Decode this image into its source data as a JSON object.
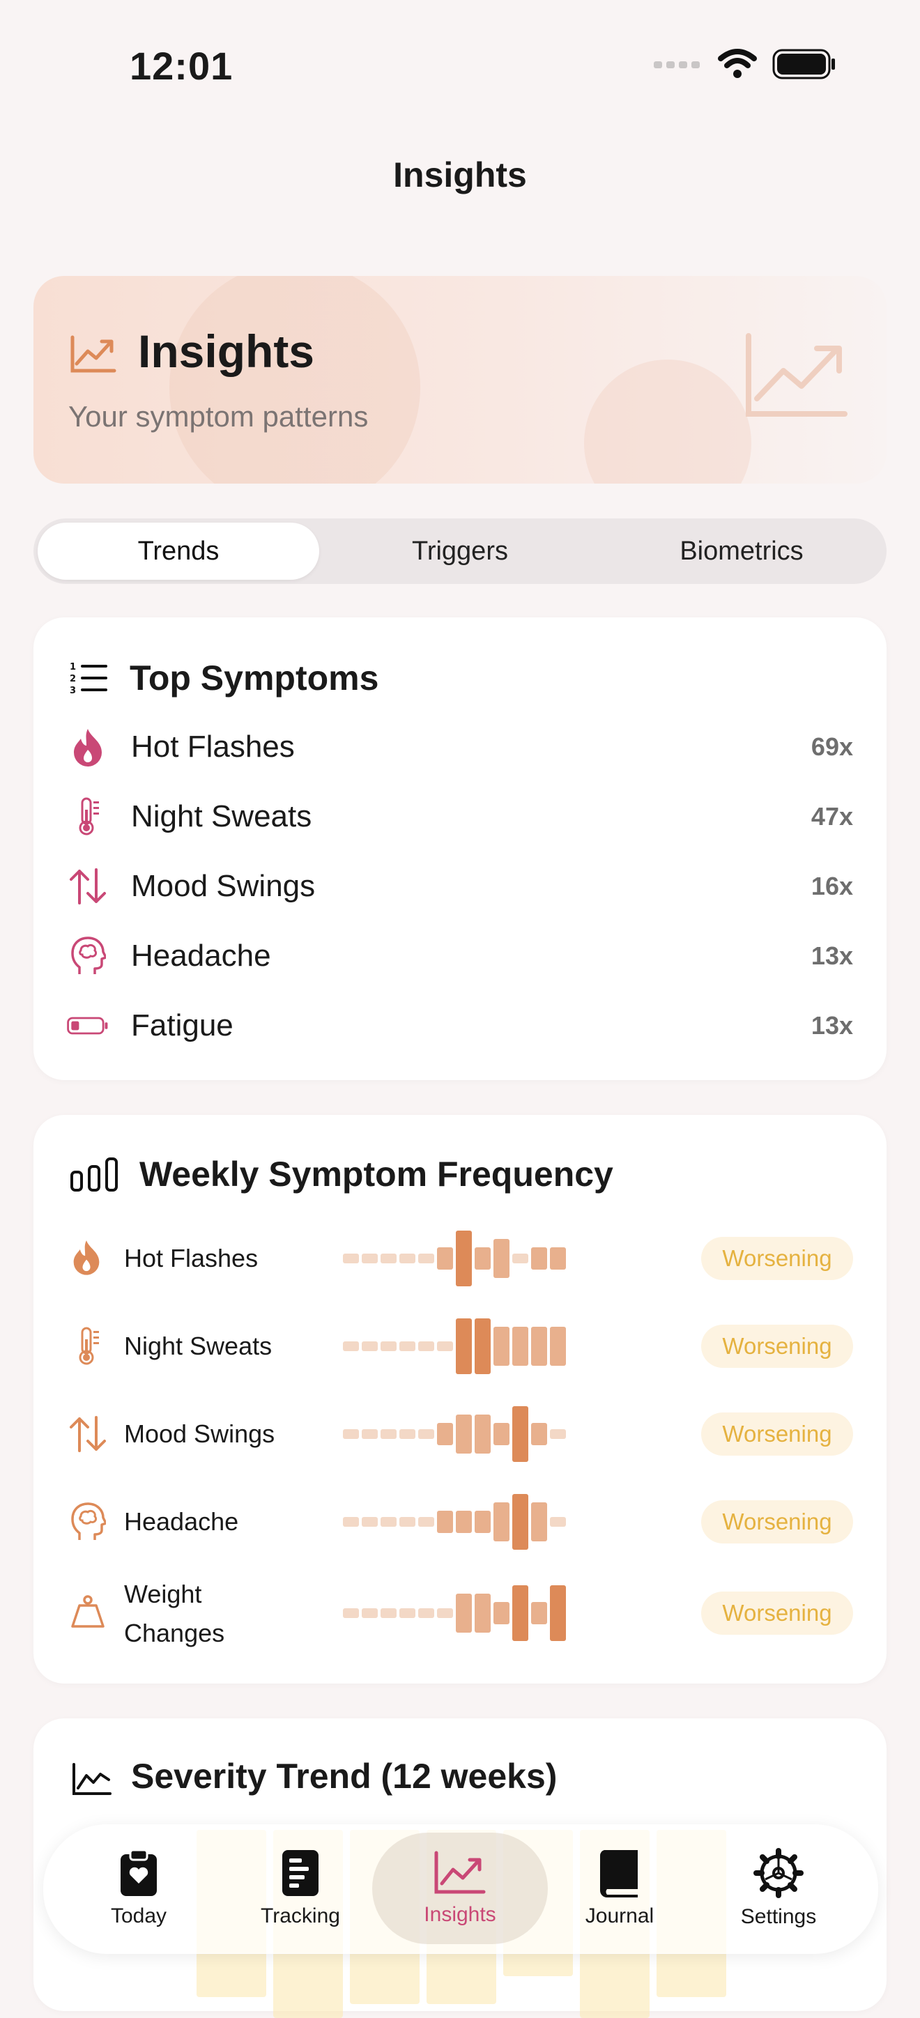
{
  "status_bar": {
    "time": "12:01"
  },
  "nav": {
    "title": "Insights"
  },
  "hero": {
    "title": "Insights",
    "subtitle": "Your symptom patterns"
  },
  "segments": [
    {
      "label": "Trends",
      "active": true
    },
    {
      "label": "Triggers",
      "active": false
    },
    {
      "label": "Biometrics",
      "active": false
    }
  ],
  "top_symptoms": {
    "title": "Top Symptoms",
    "items": [
      {
        "label": "Hot Flashes",
        "count": "69x",
        "icon": "flame-icon"
      },
      {
        "label": "Night Sweats",
        "count": "47x",
        "icon": "thermometer-icon"
      },
      {
        "label": "Mood Swings",
        "count": "16x",
        "icon": "up-down-arrows-icon"
      },
      {
        "label": "Headache",
        "count": "13x",
        "icon": "brain-head-icon"
      },
      {
        "label": "Fatigue",
        "count": "13x",
        "icon": "low-battery-icon"
      }
    ]
  },
  "weekly_frequency": {
    "title": "Weekly Symptom Frequency",
    "items": [
      {
        "label": "Hot Flashes",
        "status": "Worsening",
        "icon": "flame-icon",
        "levels": [
          1,
          1,
          1,
          1,
          1,
          2,
          4,
          2,
          3,
          1,
          2,
          2
        ]
      },
      {
        "label": "Night Sweats",
        "status": "Worsening",
        "icon": "thermometer-icon",
        "levels": [
          1,
          1,
          1,
          1,
          1,
          1,
          4,
          4,
          3,
          3,
          3,
          3
        ]
      },
      {
        "label": "Mood Swings",
        "status": "Worsening",
        "icon": "up-down-arrows-icon",
        "levels": [
          1,
          1,
          1,
          1,
          1,
          2,
          3,
          3,
          2,
          4,
          2,
          1
        ]
      },
      {
        "label": "Headache",
        "status": "Worsening",
        "icon": "brain-head-icon",
        "levels": [
          1,
          1,
          1,
          1,
          1,
          2,
          2,
          2,
          3,
          4,
          3,
          1
        ]
      },
      {
        "label": "Weight Changes",
        "status": "Worsening",
        "icon": "scale-weight-icon",
        "levels": [
          1,
          1,
          1,
          1,
          1,
          1,
          3,
          3,
          2,
          4,
          2,
          4
        ]
      }
    ]
  },
  "severity_trend": {
    "title": "Severity Trend (12 weeks)"
  },
  "tabbar": [
    {
      "label": "Today",
      "icon": "clipboard-heart-icon",
      "active": false
    },
    {
      "label": "Tracking",
      "icon": "list-document-icon",
      "active": false
    },
    {
      "label": "Insights",
      "icon": "chart-line-icon",
      "active": true
    },
    {
      "label": "Journal",
      "icon": "book-icon",
      "active": false
    },
    {
      "label": "Settings",
      "icon": "gear-icon",
      "active": false
    }
  ],
  "colors": {
    "accent_pink": "#c94876",
    "accent_orange": "#dd8a58",
    "bar_light": "#f3d8c6",
    "bar_mid": "#e8b08d",
    "bar_dark": "#dd8a58",
    "badge_bg": "#fdf3e1",
    "badge_text": "#e5b240"
  }
}
